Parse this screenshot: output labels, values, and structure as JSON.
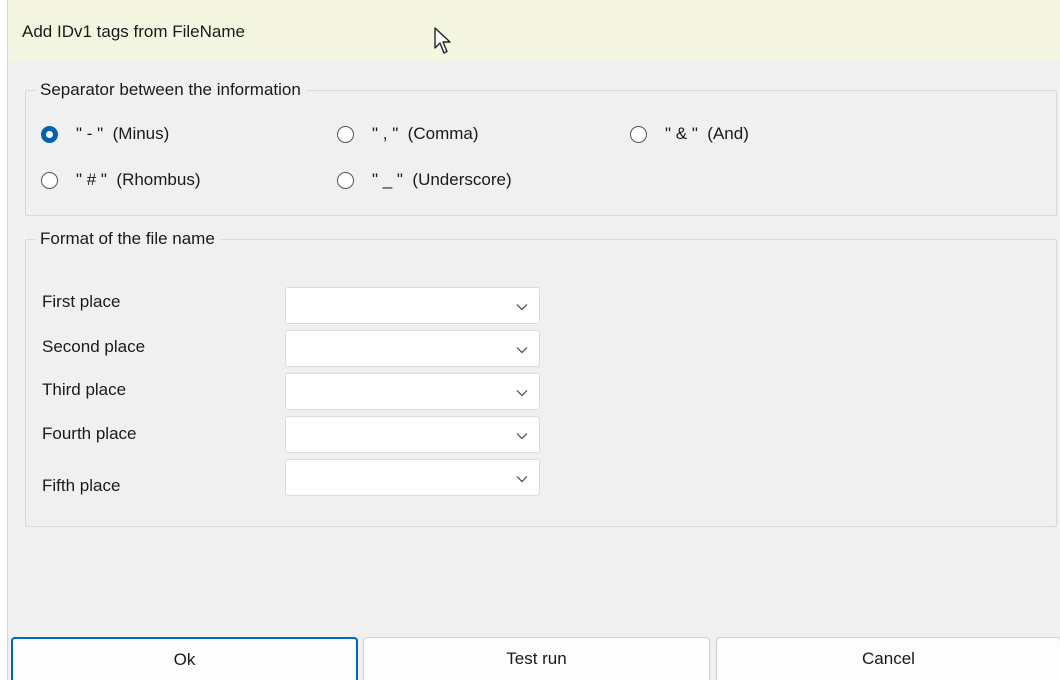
{
  "window": {
    "title": "Add IDv1 tags from FileName"
  },
  "separator_group": {
    "legend": "Separator between the information",
    "options": [
      {
        "label": "\" - \"  (Minus)",
        "checked": true
      },
      {
        "label": "\" , \"  (Comma)",
        "checked": false
      },
      {
        "label": "\" & \"  (And)",
        "checked": false
      },
      {
        "label": "\" # \"  (Rhombus)",
        "checked": false
      },
      {
        "label": "\" _ \"  (Underscore)",
        "checked": false
      }
    ]
  },
  "format_group": {
    "legend": "Format of the file name",
    "fields": [
      {
        "label": "First place",
        "value": ""
      },
      {
        "label": "Second place",
        "value": ""
      },
      {
        "label": "Third place",
        "value": ""
      },
      {
        "label": "Fourth place",
        "value": ""
      },
      {
        "label": "Fifth place",
        "value": ""
      }
    ]
  },
  "buttons": {
    "ok": "Ok",
    "test_run": "Test run",
    "cancel": "Cancel"
  },
  "colors": {
    "accent": "#0063b1",
    "titlebar": "#f5f6e2",
    "dialog_bg": "#f0f0f0"
  },
  "icons": {
    "cursor": "mouse-pointer-icon",
    "dropdown": "chevron-down-icon"
  }
}
